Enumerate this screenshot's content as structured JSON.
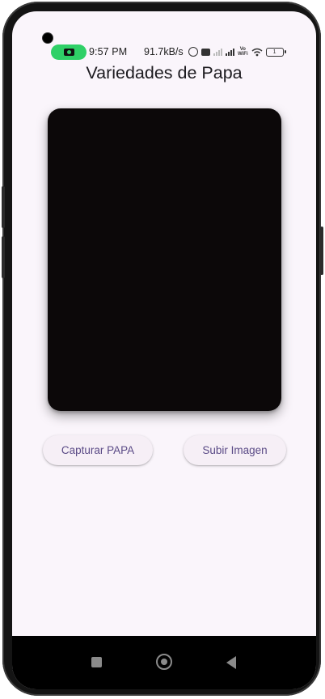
{
  "status_bar": {
    "time": "9:57 PM",
    "network_speed": "91.7kB/s",
    "vo_label_top": "Vo",
    "vo_label_bottom": "WiFi",
    "battery_level": "1",
    "icons": [
      "screen-record-icon",
      "alarm-icon",
      "hd-icon",
      "signal-icon",
      "signal-icon",
      "vowifi-icon",
      "wifi-icon",
      "battery-icon"
    ]
  },
  "app": {
    "title": "Variedades de Papa",
    "buttons": {
      "capture_label": "Capturar PAPA",
      "upload_label": "Subir Imagen"
    }
  },
  "nav": {
    "icons": [
      "recents-icon",
      "home-icon",
      "back-icon"
    ]
  },
  "colors": {
    "background": "#faf5fb",
    "preview": "#0c0809",
    "button_text": "#5a4a86",
    "record_indicator": "#2fd067"
  }
}
